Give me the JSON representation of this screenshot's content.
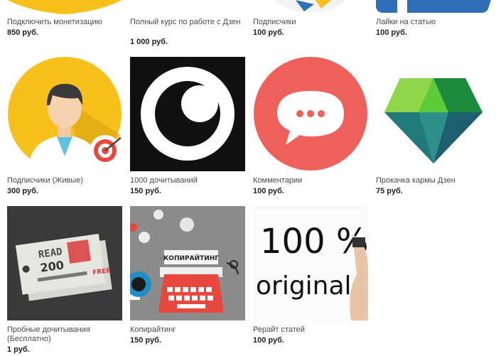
{
  "products": [
    {
      "title": "Подключить монетизацию",
      "price": "850 руб."
    },
    {
      "title": "Полный курс по работе с Дзен",
      "price": "1 000 руб."
    },
    {
      "title": "Подписчики",
      "price": "100 руб."
    },
    {
      "title": "Лайки на статью",
      "price": "100 руб."
    },
    {
      "title": "Подписчики (Живые)",
      "price": "300 руб."
    },
    {
      "title": "1000 дочитываний",
      "price": "150 руб."
    },
    {
      "title": "Комментарии",
      "price": "100 руб."
    },
    {
      "title": "Прокачка кармы Дзен",
      "price": "75 руб."
    },
    {
      "title": "Пробные дочитывания (Бесплатно)",
      "price": "1 руб."
    },
    {
      "title": "Копирайтинг",
      "price": "150 руб."
    },
    {
      "title": "Рерайт статей",
      "price": "100 руб."
    }
  ],
  "image_text": {
    "ticket_read": "READ",
    "ticket_number": "200",
    "ticket_free": "FREE",
    "copywriting_sign": "КОПИРАЙТИНГ",
    "original_100": "100 %",
    "original_word": "original"
  },
  "colors": {
    "yellow": "#F8C01A",
    "coral": "#F0605A",
    "blue": "#2F6FB8",
    "black": "#111111",
    "gray": "#8a8a8a",
    "green": "#34A853"
  }
}
